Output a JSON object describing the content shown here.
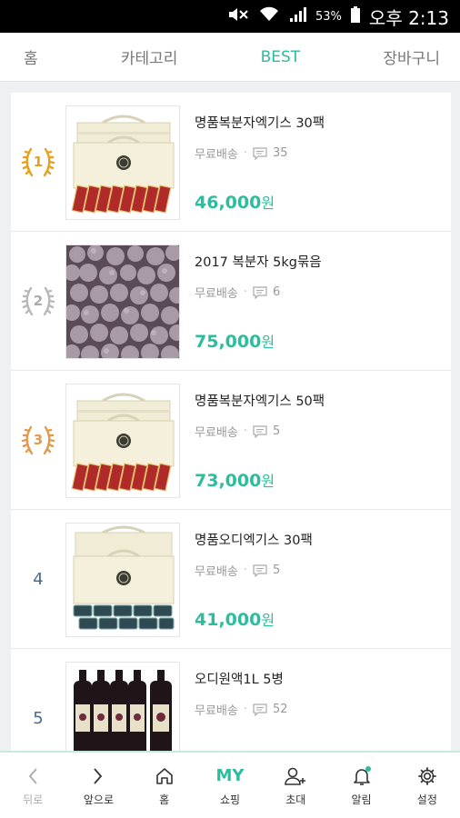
{
  "status_bar": {
    "battery": "53%",
    "time": "오후 2:13"
  },
  "top_nav": {
    "tabs": [
      {
        "label": "홈"
      },
      {
        "label": "카테고리"
      },
      {
        "label": "BEST"
      },
      {
        "label": "장바구니"
      }
    ],
    "active_tab": "BEST"
  },
  "products": [
    {
      "rank": "1",
      "name": "명품복분자엑기스 30팩",
      "shipping": "무료배송",
      "comments": "35",
      "price": "46,000",
      "currency": "원",
      "image": "boxed-extract-30"
    },
    {
      "rank": "2",
      "name": "2017 복분자 5kg묶음",
      "shipping": "무료배송",
      "comments": "6",
      "price": "75,000",
      "currency": "원",
      "image": "frozen-berries"
    },
    {
      "rank": "3",
      "name": "명품복분자엑기스 50팩",
      "shipping": "무료배송",
      "comments": "5",
      "price": "73,000",
      "currency": "원",
      "image": "boxed-extract-50"
    },
    {
      "rank": "4",
      "name": "명품오디엑기스 30팩",
      "shipping": "무료배송",
      "comments": "5",
      "price": "41,000",
      "currency": "원",
      "image": "boxed-mulberry"
    },
    {
      "rank": "5",
      "name": "오디원액1L 5병",
      "shipping": "무료배송",
      "comments": "52",
      "price": "",
      "currency": "",
      "image": "bottles"
    }
  ],
  "bottom_bar": {
    "items": [
      {
        "label": "뒤로",
        "icon": "chevron-left-icon"
      },
      {
        "label": "앞으로",
        "icon": "chevron-right-icon"
      },
      {
        "label": "홈",
        "icon": "home-icon"
      },
      {
        "label": "쇼핑",
        "icon_text": "MY"
      },
      {
        "label": "초대",
        "icon": "add-user-icon"
      },
      {
        "label": "알림",
        "icon": "bell-icon"
      },
      {
        "label": "설정",
        "icon": "gear-icon"
      }
    ]
  },
  "colors": {
    "accent": "#2bbd9e",
    "gold": "#e8a020",
    "silver": "#b9b9b9",
    "bronze": "#e39a4c",
    "rank_plain": "#4a6c8c"
  }
}
